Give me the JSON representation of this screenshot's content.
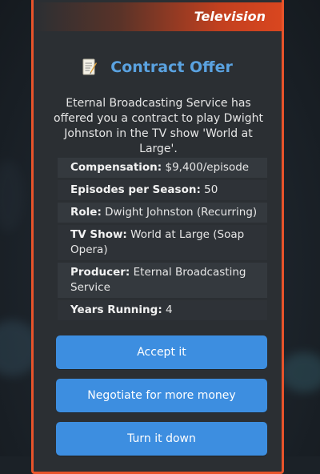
{
  "category": "Television",
  "dialog": {
    "title": "Contract Offer",
    "intro": "Eternal Broadcasting Service has offered you a contract to play Dwight Johnston in the TV show 'World at Large'."
  },
  "details": [
    {
      "key": "Compensation:",
      "value": "$9,400/episode"
    },
    {
      "key": "Episodes per Season:",
      "value": "50"
    },
    {
      "key": "Role:",
      "value": "Dwight Johnston (Recurring)"
    },
    {
      "key": "TV Show:",
      "value": "World at Large (Soap Opera)"
    },
    {
      "key": "Producer:",
      "value": "Eternal Broadcasting Service"
    },
    {
      "key": "Years Running:",
      "value": "4"
    }
  ],
  "buttons": {
    "accept": "Accept it",
    "negotiate": "Negotiate for more money",
    "decline": "Turn it down"
  },
  "colors": {
    "accent_border": "#e8532a",
    "title_blue": "#5aa2e0",
    "button_blue": "#3d8ee0",
    "modal_bg": "#2b2f33"
  },
  "icons": {
    "title": "memo-icon"
  }
}
